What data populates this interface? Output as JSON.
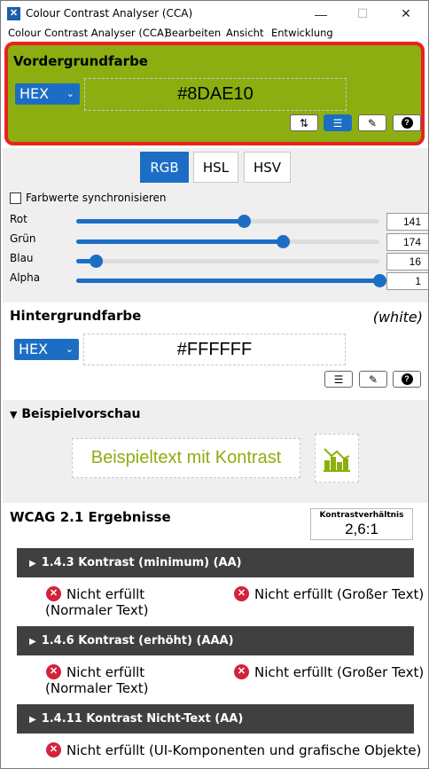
{
  "window": {
    "title": "Colour Contrast Analyser (CCA)",
    "minimize_glyph": "—",
    "maximize_glyph": "☐",
    "close_glyph": "✕"
  },
  "menu": [
    "Colour Contrast Analyser (CCA)",
    "Bearbeiten",
    "Ansicht",
    "Entwicklung"
  ],
  "foreground": {
    "title": "Vordergrundfarbe",
    "format": "HEX",
    "value": "#8DAE10",
    "color": "#8DAE10",
    "tools": [
      "swap-icon",
      "sliders-icon",
      "eyedropper-icon",
      "help-icon"
    ]
  },
  "color_model": {
    "tabs": [
      "RGB",
      "HSL",
      "HSV"
    ],
    "active": "RGB",
    "sync_label": "Farbwerte synchronisieren",
    "sync_checked": false
  },
  "sliders": [
    {
      "label": "Rot",
      "value": "141",
      "fraction": 0.553
    },
    {
      "label": "Grün",
      "value": "174",
      "fraction": 0.682
    },
    {
      "label": "Blau",
      "value": "16",
      "fraction": 0.063
    },
    {
      "label": "Alpha",
      "value": "1",
      "fraction": 1.0
    }
  ],
  "background": {
    "title": "Hintergrundfarbe",
    "name": "(white)",
    "format": "HEX",
    "value": "#FFFFFF",
    "tools": [
      "sliders-icon",
      "eyedropper-icon",
      "help-icon"
    ]
  },
  "preview": {
    "title": "Beispielvorschau",
    "toggle_glyph": "▼",
    "sample_text": "Beispieltext mit Kontrast",
    "graphic_icon": "chart-icon"
  },
  "results": {
    "title": "WCAG 2.1 Ergebnisse",
    "ratio_label": "Kontrastverhältnis",
    "ratio_value": "2,6:1",
    "criteria": [
      {
        "label": "1.4.3 Kontrast (minimum) (AA)",
        "items": [
          "Nicht erfüllt (Normaler Text)",
          "Nicht erfüllt (Großer Text)"
        ]
      },
      {
        "label": "1.4.6 Kontrast (erhöht) (AAA)",
        "items": [
          "Nicht erfüllt (Normaler Text)",
          "Nicht erfüllt (Großer Text)"
        ]
      },
      {
        "label": "1.4.11 Kontrast Nicht-Text (AA)",
        "items": [
          "Nicht erfüllt (UI-Komponenten und grafische Objekte)"
        ]
      }
    ],
    "fail_icon": "fail-icon",
    "expand_glyph": "▶"
  },
  "colors": {
    "accent": "#1c6ec4",
    "highlight_border": "#e8231e",
    "fail": "#d2233a",
    "criteria_bar": "#404040"
  }
}
